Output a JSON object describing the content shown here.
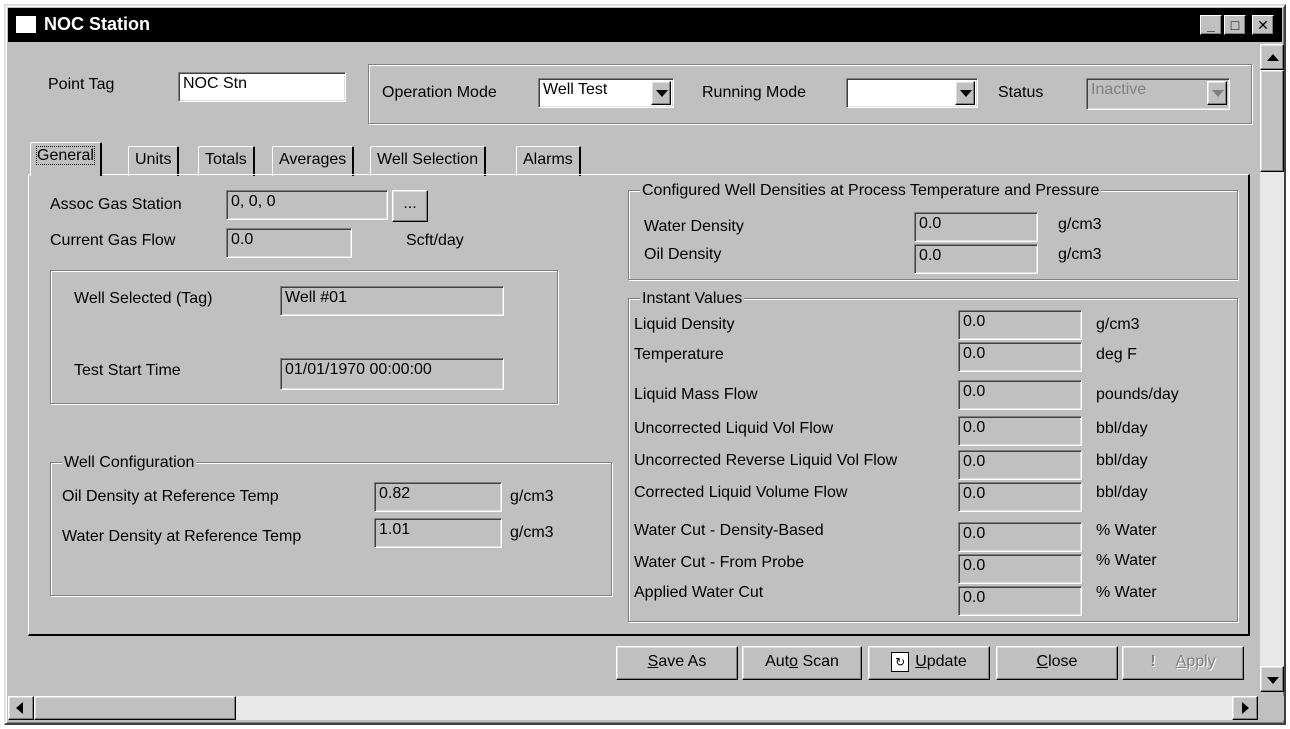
{
  "window": {
    "title": "NOC Station",
    "min_glyph": "_",
    "max_glyph": "□",
    "close_glyph": "✕"
  },
  "header": {
    "point_tag_label": "Point Tag",
    "point_tag_value": "NOC Stn",
    "operation_mode_label": "Operation Mode",
    "operation_mode_value": "Well Test",
    "running_mode_label": "Running Mode",
    "running_mode_value": "",
    "status_label": "Status",
    "status_value": "Inactive"
  },
  "tabs": [
    {
      "label": "General",
      "active": true
    },
    {
      "label": "Units"
    },
    {
      "label": "Totals"
    },
    {
      "label": "Averages"
    },
    {
      "label": "Well Selection"
    },
    {
      "label": "Alarms"
    }
  ],
  "general": {
    "assoc_gas_label": "Assoc Gas Station",
    "assoc_gas_value": "0, 0, 0",
    "browse_label": "...",
    "current_gas_label": "Current Gas Flow",
    "current_gas_value": "0.0",
    "current_gas_unit": "Scft/day",
    "well_selected_label": "Well Selected (Tag)",
    "well_selected_value": "Well #01",
    "test_start_label": "Test Start Time",
    "test_start_value": "01/01/1970 00:00:00",
    "well_config": {
      "legend": "Well Configuration",
      "oil_label": "Oil Density at Reference Temp",
      "oil_value": "0.82",
      "oil_unit": "g/cm3",
      "water_label": "Water Density at Reference Temp",
      "water_value": "1.01",
      "water_unit": "g/cm3"
    }
  },
  "configured": {
    "legend": "Configured Well Densities at Process Temperature and Pressure",
    "rows": [
      {
        "label": "Water Density",
        "value": "0.0",
        "unit": "g/cm3"
      },
      {
        "label": "Oil Density",
        "value": "0.0",
        "unit": "g/cm3"
      }
    ]
  },
  "instant": {
    "legend": "Instant Values",
    "rows": [
      {
        "label": "Liquid Density",
        "value": "0.0",
        "unit": "g/cm3"
      },
      {
        "label": "Temperature",
        "value": "0.0",
        "unit": "deg F"
      },
      {
        "label": "Liquid Mass Flow",
        "value": "0.0",
        "unit": "pounds/day"
      },
      {
        "label": "Uncorrected Liquid Vol Flow",
        "value": "0.0",
        "unit": "bbl/day"
      },
      {
        "label": "Uncorrected Reverse Liquid Vol Flow",
        "value": "0.0",
        "unit": "bbl/day"
      },
      {
        "label": "Corrected Liquid Volume Flow",
        "value": "0.0",
        "unit": "bbl/day"
      },
      {
        "label": "Water Cut - Density-Based",
        "value": "0.0",
        "unit": "% Water"
      },
      {
        "label": "Water Cut - From Probe",
        "value": "0.0",
        "unit": "% Water"
      },
      {
        "label": "Applied Water Cut",
        "value": "0.0",
        "unit": "% Water"
      }
    ]
  },
  "buttons": {
    "save_as_pre": "",
    "save_as_key": "S",
    "save_as_post": "ave As",
    "auto_scan_pre": "Aut",
    "auto_scan_key": "o",
    "auto_scan_post": " Scan",
    "update_pre": "",
    "update_key": "U",
    "update_post": "pdate",
    "close_pre": "",
    "close_key": "C",
    "close_post": "lose",
    "apply_pre": "",
    "apply_key": "A",
    "apply_post": "pply",
    "apply_icon": "!"
  }
}
